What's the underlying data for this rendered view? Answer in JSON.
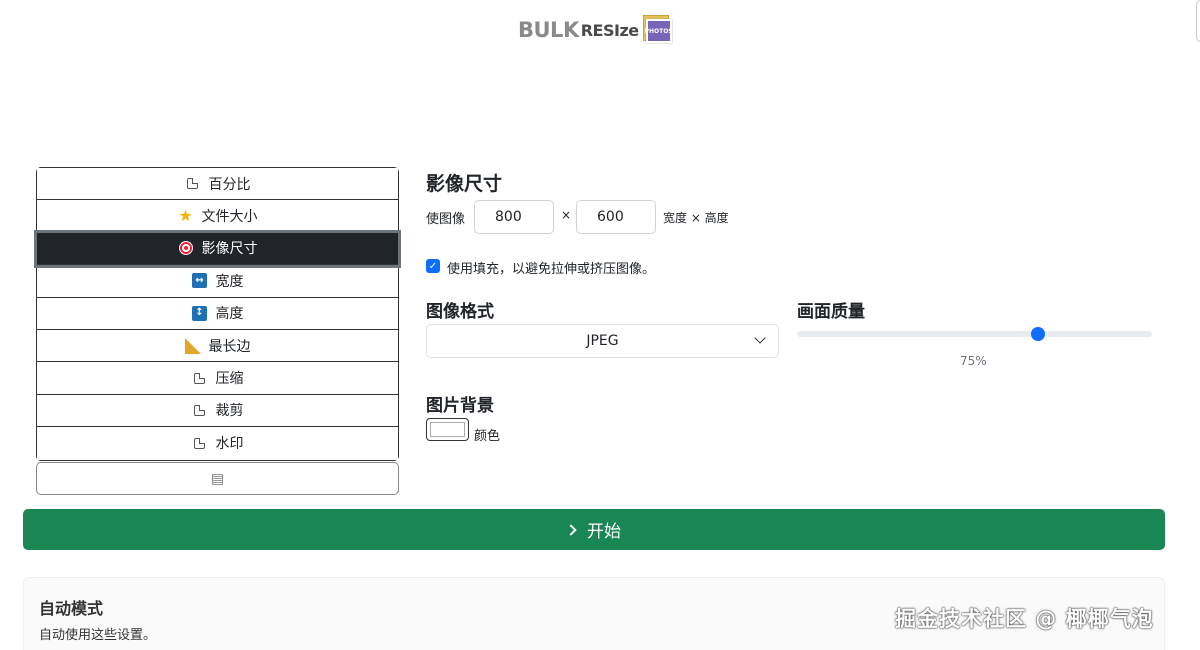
{
  "logo": {
    "bulk": "BULK",
    "resize": "RESIze",
    "photos": "PHOTOS"
  },
  "menu": {
    "items": [
      {
        "label": "百分比",
        "icon": "external-square-icon"
      },
      {
        "label": "文件大小",
        "icon": "star-icon"
      },
      {
        "label": "影像尺寸",
        "icon": "target-icon",
        "active": true
      },
      {
        "label": "宽度",
        "icon": "horizontal-arrows-icon"
      },
      {
        "label": "高度",
        "icon": "vertical-arrows-icon"
      },
      {
        "label": "最长边",
        "icon": "ruler-triangle-icon"
      },
      {
        "label": "压缩",
        "icon": "external-link-icon"
      },
      {
        "label": "裁剪",
        "icon": "external-link-icon"
      },
      {
        "label": "水印",
        "icon": "external-link-icon"
      }
    ],
    "list_icon": "▤"
  },
  "resize": {
    "title": "影像尺寸",
    "prefix": "使图像",
    "width": "800",
    "times": "×",
    "height": "600",
    "suffix": "宽度 × 高度",
    "fill_checkbox_label": "使用填充，以避免拉伸或挤压图像。",
    "fill_checked": true
  },
  "format": {
    "title": "图像格式",
    "selected": "JPEG"
  },
  "quality": {
    "title": "画面质量",
    "value_label": "75%",
    "value": 75
  },
  "background": {
    "title": "图片背景",
    "color_label": "颜色",
    "color": "#ffffff"
  },
  "start_button": {
    "label": "开始"
  },
  "auto_mode": {
    "title": "自动模式",
    "description": "自动使用这些设置。"
  },
  "watermark": "掘金技术社区 @ 椰椰气泡",
  "colors": {
    "accent": "#0d6efd",
    "start": "#198754",
    "active_menu": "#212529"
  }
}
